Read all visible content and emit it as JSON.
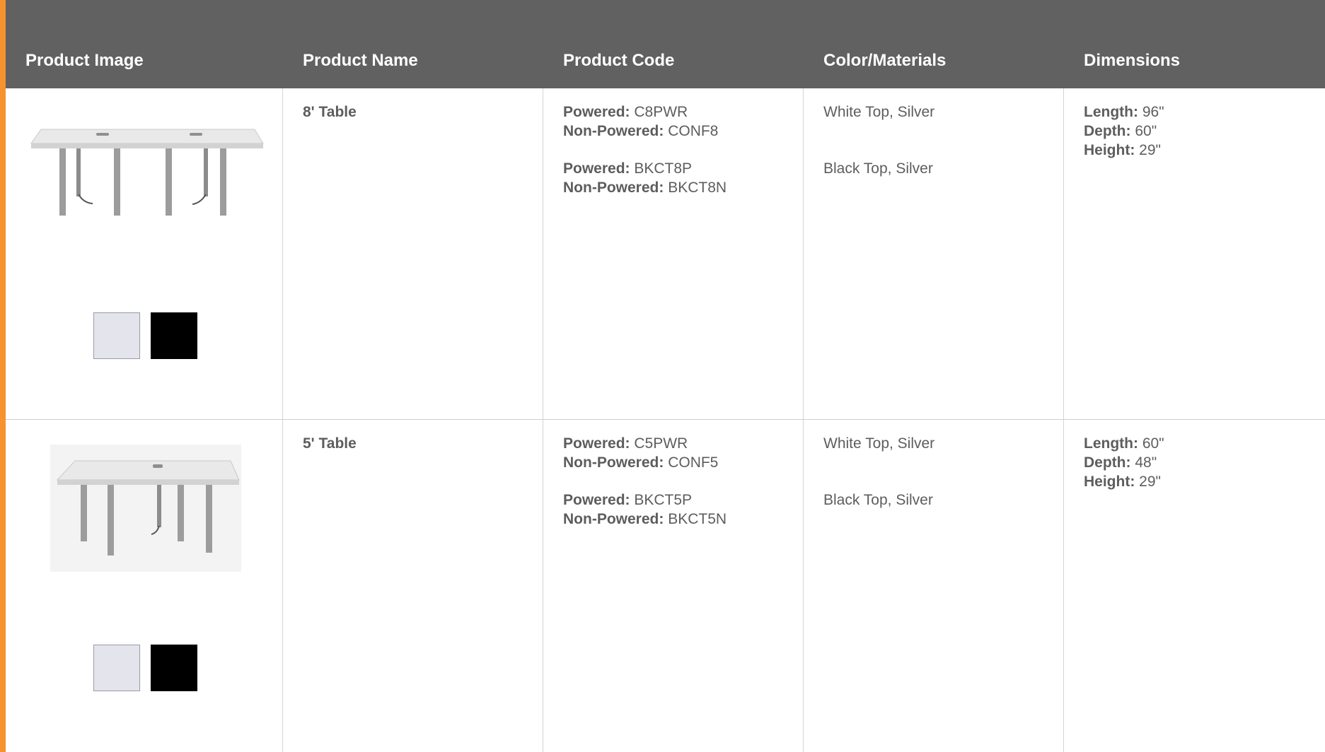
{
  "headers": {
    "product_image": "Product Image",
    "product_name": "Product Name",
    "product_code": "Product Code",
    "color_materials": "Color/Materials",
    "dimensions": "Dimensions"
  },
  "rows": [
    {
      "name": "8' Table",
      "codes": [
        {
          "powered_label": "Powered:",
          "powered": "C8PWR",
          "nonpowered_label": "Non-Powered:",
          "nonpowered": "CONF8"
        },
        {
          "powered_label": "Powered:",
          "powered": "BKCT8P",
          "nonpowered_label": "Non-Powered:",
          "nonpowered": "BKCT8N"
        }
      ],
      "colors": [
        "White Top, Silver",
        "Black Top, Silver"
      ],
      "dimensions": {
        "length_label": "Length:",
        "length": "96\"",
        "depth_label": "Depth:",
        "depth": "60\"",
        "height_label": "Height:",
        "height": "29\""
      },
      "swatches": [
        "#e4e4ec",
        "#000000"
      ]
    },
    {
      "name": "5' Table",
      "codes": [
        {
          "powered_label": "Powered:",
          "powered": "C5PWR",
          "nonpowered_label": "Non-Powered:",
          "nonpowered": "CONF5"
        },
        {
          "powered_label": "Powered:",
          "powered": "BKCT5P",
          "nonpowered_label": "Non-Powered:",
          "nonpowered": "BKCT5N"
        }
      ],
      "colors": [
        "White Top, Silver",
        "Black Top, Silver"
      ],
      "dimensions": {
        "length_label": "Length:",
        "length": "60\"",
        "depth_label": "Depth:",
        "depth": "48\"",
        "height_label": "Height:",
        "height": "29\""
      },
      "swatches": [
        "#e4e4ec",
        "#000000"
      ]
    }
  ],
  "colors": {
    "accent": "#f7932e",
    "header_bg": "#616161",
    "text": "#5d5d5d"
  }
}
